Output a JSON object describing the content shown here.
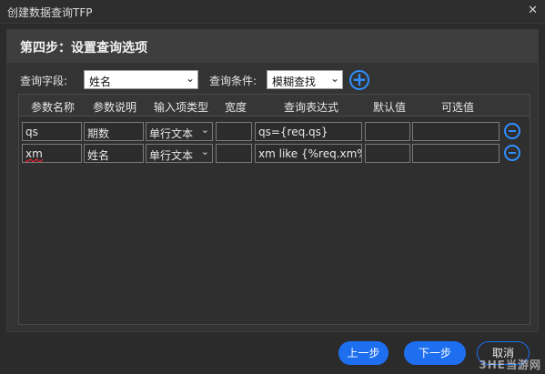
{
  "window": {
    "title": "创建数据查询TFP",
    "close_glyph": "✕"
  },
  "step": {
    "title": "第四步：设置查询选项"
  },
  "filters": {
    "field_label": "查询字段:",
    "field_value": "姓名",
    "condition_label": "查询条件:",
    "condition_value": "模糊查找"
  },
  "table": {
    "headers": [
      "参数名称",
      "参数说明",
      "输入项类型",
      "宽度",
      "查询表达式",
      "默认值",
      "可选值"
    ],
    "rows": [
      {
        "name": "qs",
        "desc": "期数",
        "type": "单行文本",
        "width": "",
        "expr": "qs={req.qs}",
        "default": "",
        "options": ""
      },
      {
        "name": "xm",
        "desc": "姓名",
        "type": "单行文本",
        "width": "",
        "expr": "xm like {%req.xm%}",
        "default": "",
        "options": ""
      }
    ]
  },
  "footer": {
    "prev": "上一步",
    "next": "下一步",
    "cancel": "取消"
  },
  "watermark": "3HE当游网",
  "colors": {
    "accent": "#1e6ff0",
    "icon_blue": "#2f8fff"
  }
}
